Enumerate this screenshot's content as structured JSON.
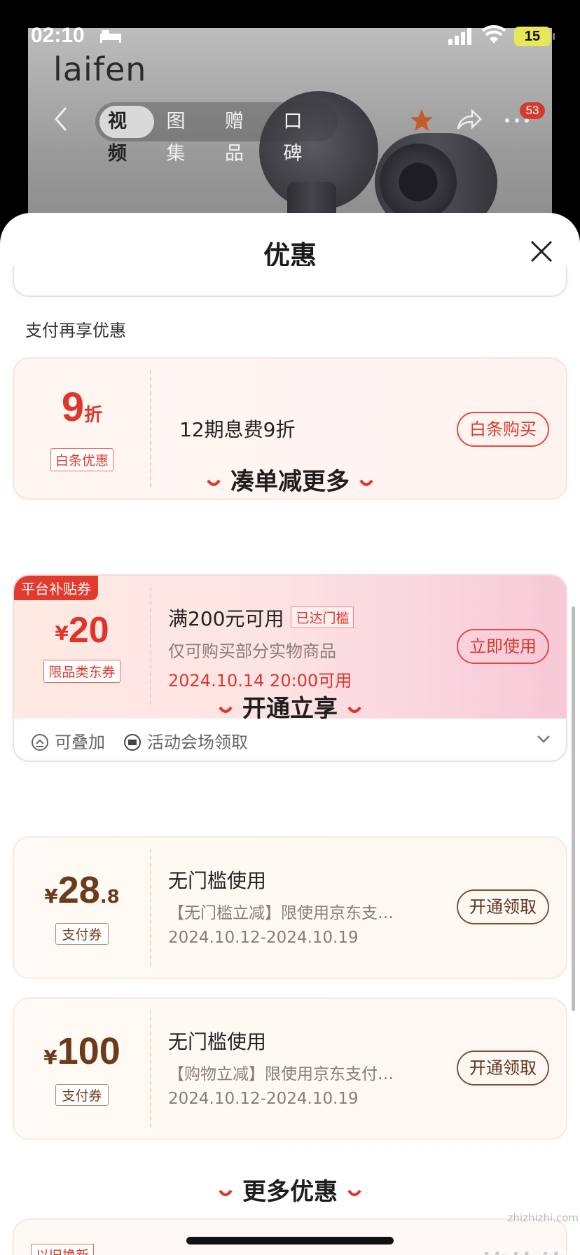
{
  "status": {
    "time": "02:10",
    "battery": "15"
  },
  "brand": {
    "logo": "laifen"
  },
  "nav": {
    "tabs": [
      "视频",
      "图集",
      "赠品",
      "口碑"
    ],
    "active_tab": 0,
    "more_badge": "53"
  },
  "sheet": {
    "title": "优惠",
    "pay_section_label": "支付再享优惠",
    "baitiao": {
      "num": "9",
      "unit": "折",
      "tag": "白条优惠",
      "text": "12期息费9折",
      "button": "白条购买"
    },
    "section_combine": "凑单减更多",
    "platform_coupon": {
      "ribbon": "平台补贴券",
      "yen": "¥",
      "amount": "20",
      "tag": "限品类东券",
      "title": "满200元可用",
      "flag": "已达门槛",
      "desc": "仅可购买部分实物商品",
      "date": "2024.10.14 20:00可用",
      "button": "立即使用",
      "footer_stackable": "可叠加",
      "footer_venue": "活动会场领取"
    },
    "section_open": "开通立享",
    "pay_coupons": [
      {
        "yen": "¥",
        "amount": "28",
        "decimal": ".8",
        "tag": "支付券",
        "title": "无门槛使用",
        "desc": "【无门槛立减】限使用京东支…",
        "date": "2024.10.12-2024.10.19",
        "button": "开通领取"
      },
      {
        "yen": "¥",
        "amount": "100",
        "decimal": "",
        "tag": "支付券",
        "title": "无门槛使用",
        "desc": "【购物立减】限使用京东支付…",
        "date": "2024.10.12-2024.10.19",
        "button": "开通领取"
      }
    ],
    "section_more": "更多优惠",
    "more_first_tag": "以旧换新"
  },
  "watermark": {
    "text": "值值值",
    "sub": "zhizhizhi.com"
  },
  "colors": {
    "accent_red": "#e0352a",
    "brown": "#6b3b1b"
  }
}
